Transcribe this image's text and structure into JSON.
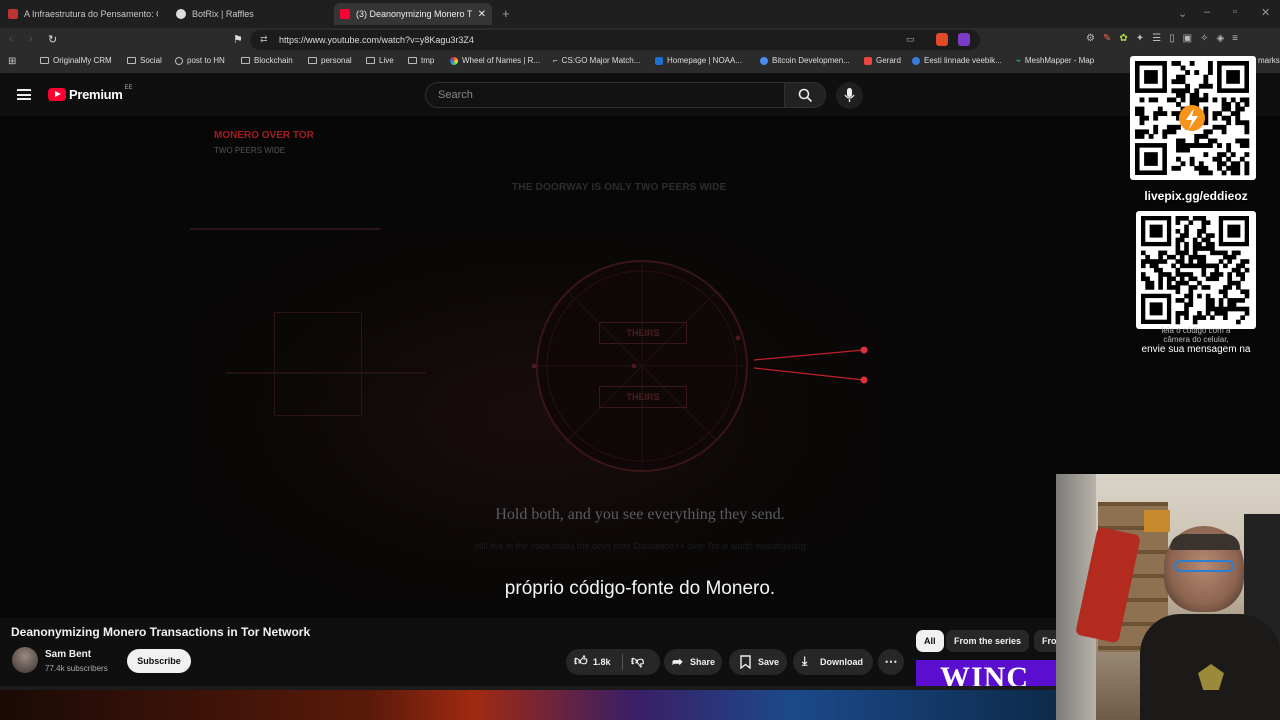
{
  "browser": {
    "tabs": [
      {
        "title": "A Infraestrutura do Pensamento: Com",
        "active": false
      },
      {
        "title": "BotRix | Raffles",
        "active": false
      },
      {
        "title": "(3) Deanonymizing Monero T",
        "active": true
      }
    ],
    "url": "https://www.youtube.com/watch?v=y8Kagu3r3Z4",
    "bookmarks": [
      "OriginalMy CRM",
      "Social",
      "post to HN",
      "Blockchain",
      "personal",
      "Live",
      "tmp",
      "Wheel of Names | R...",
      "CS:GO Major Match...",
      "Homepage | NOAA...",
      "Bitcoin Developmen...",
      "Gerard",
      "Eesti linnade veebik...",
      "MeshMapper - Map",
      "marks"
    ]
  },
  "youtube": {
    "logo_text": "Premium",
    "logo_badge": "EE",
    "search_placeholder": "Search"
  },
  "video": {
    "top_label": "MONERO OVER TOR",
    "top_sublabel": "TWO PEERS WIDE",
    "headline": "THE DOORWAY IS ONLY TWO PEERS WIDE",
    "box1": "THEIRS",
    "box2": "THEIRS",
    "caption_line": "Hold both, and you see everything they send.",
    "caption_sub": "still live in the code today   the devs note Dandelion++ over Tor is worth investigating",
    "subtitle": "próprio código-fonte do Monero."
  },
  "info": {
    "title": "Deanonymizing Monero Transactions in Tor Network",
    "channel": "Sam Bent",
    "subscribers": "77.4k subscribers",
    "subscribe": "Subscribe",
    "likes": "1.8k",
    "share": "Share",
    "save": "Save",
    "download": "Download",
    "chips": [
      "All",
      "From the series",
      "Fro"
    ],
    "banner_text": "WINC"
  },
  "overlay": {
    "qr_url": "livepix.gg/eddieoz",
    "qr_caption_line1": "leia o código com a",
    "qr_caption_line2": "câmera do celular,",
    "qr_caption_line3": "envie sua mensagem na"
  },
  "colors": {
    "accent_red": "#ff0033",
    "video_red": "#c0202a"
  }
}
